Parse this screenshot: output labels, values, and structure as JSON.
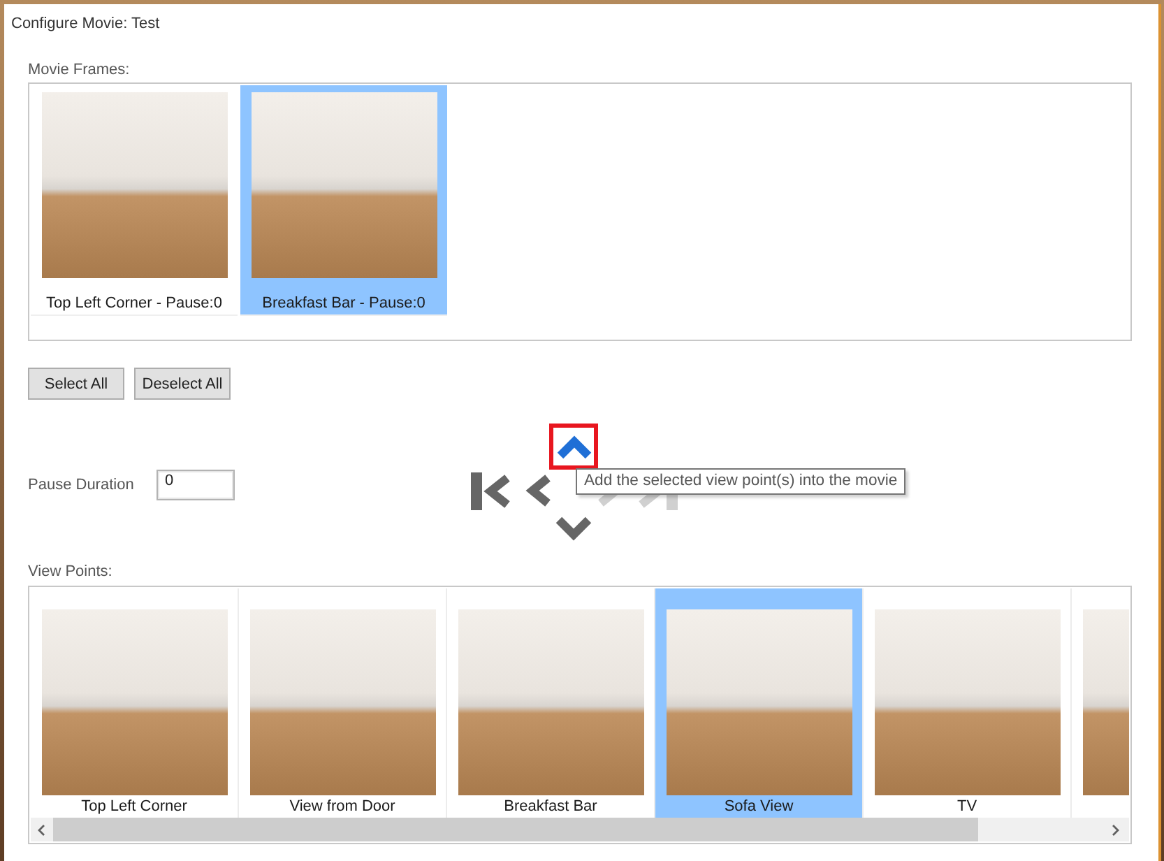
{
  "window": {
    "title": "Configure Movie: Test"
  },
  "movie_frames": {
    "label": "Movie Frames:",
    "items": [
      {
        "caption": "Top Left Corner - Pause:0",
        "selected": false
      },
      {
        "caption": "Breakfast Bar - Pause:0",
        "selected": true
      }
    ]
  },
  "selection_buttons": [
    {
      "label": "Select All"
    },
    {
      "label": "Deselect All"
    }
  ],
  "pause_duration": {
    "label": "Pause Duration",
    "value": "0"
  },
  "navigation": {
    "buttons": [
      {
        "kind": "up",
        "hovered": true,
        "highlighted": true,
        "disabled": false
      },
      {
        "kind": "first",
        "hovered": false,
        "highlighted": false,
        "disabled": false
      },
      {
        "kind": "previous",
        "hovered": false,
        "highlighted": false,
        "disabled": false
      },
      {
        "kind": "next",
        "hovered": false,
        "highlighted": false,
        "disabled": true
      },
      {
        "kind": "last",
        "hovered": false,
        "highlighted": false,
        "disabled": true
      },
      {
        "kind": "down",
        "hovered": false,
        "highlighted": false,
        "disabled": false
      }
    ],
    "tooltip": "Add the selected view point(s) into the movie"
  },
  "view_points": {
    "label": "View Points:",
    "items": [
      {
        "caption": "Top Left Corner",
        "selected": false
      },
      {
        "caption": "View from Door",
        "selected": false
      },
      {
        "caption": "Breakfast Bar",
        "selected": false
      },
      {
        "caption": "Sofa View",
        "selected": true
      },
      {
        "caption": "TV",
        "selected": false
      },
      {
        "selected": false
      }
    ]
  }
}
